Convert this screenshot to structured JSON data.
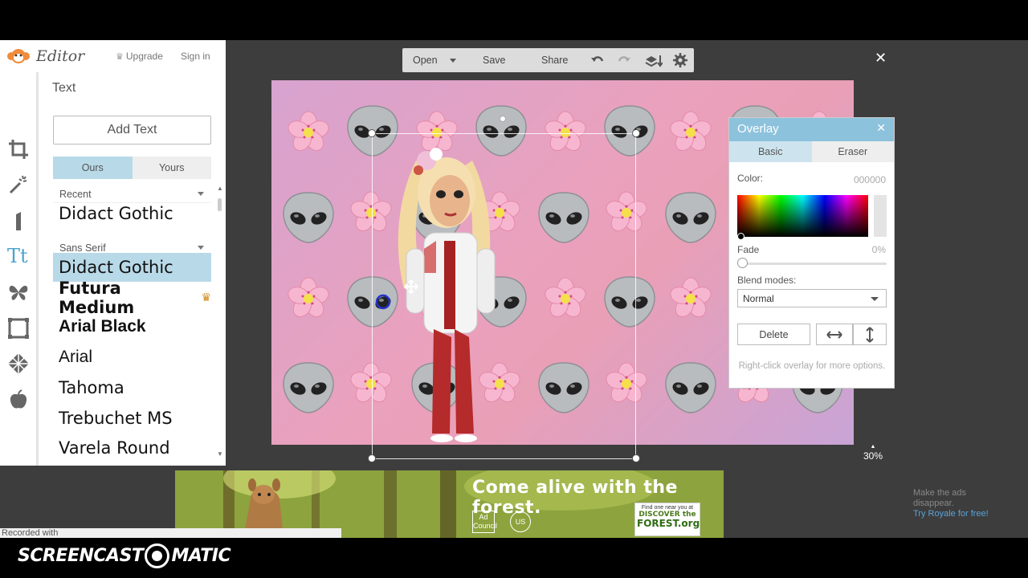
{
  "app": {
    "logo_text": "Editor",
    "upgrade": "Upgrade",
    "signin": "Sign in"
  },
  "toolbar": {
    "open": "Open",
    "save": "Save",
    "share": "Share"
  },
  "text_panel": {
    "title": "Text",
    "add_text": "Add Text",
    "tabs": [
      "Ours",
      "Yours"
    ],
    "active_tab": "Ours",
    "category_recent": "Recent",
    "category_sans": "Sans Serif",
    "fonts_recent": [
      "Didact Gothic"
    ],
    "fonts": [
      "Didact Gothic",
      "Futura Medium",
      "Arial Black",
      "Arial",
      "Tahoma",
      "Trebuchet MS",
      "Varela Round"
    ],
    "selected_font": "Didact Gothic"
  },
  "overlay": {
    "title": "Overlay",
    "tabs": [
      "Basic",
      "Eraser"
    ],
    "active_tab": "Basic",
    "color_label": "Color:",
    "color_value": "000000",
    "fade_label": "Fade",
    "fade_value": "0%",
    "blend_label": "Blend modes:",
    "blend_value": "Normal",
    "delete_label": "Delete",
    "hint": "Right-click overlay for more options."
  },
  "zoom": "30%",
  "ad": {
    "headline": "Come alive with the forest.",
    "badge_line1": "Find one near you at",
    "badge_line2": "DISCOVER the",
    "badge_line3": "FOREST.org",
    "logo1": "Ad Council",
    "logo2": "US"
  },
  "ads_notice": {
    "line1": "Make the ads",
    "line2": "disappear.",
    "link": "Try Royale for free!"
  },
  "recorded_text": "Recorded with",
  "screencast_logo": {
    "left": "SCREENCAST",
    "right": "MATIC"
  },
  "colors": {
    "accent": "#8dc2dc",
    "selected": "#b8d9e8",
    "crown": "#d38a1a"
  }
}
